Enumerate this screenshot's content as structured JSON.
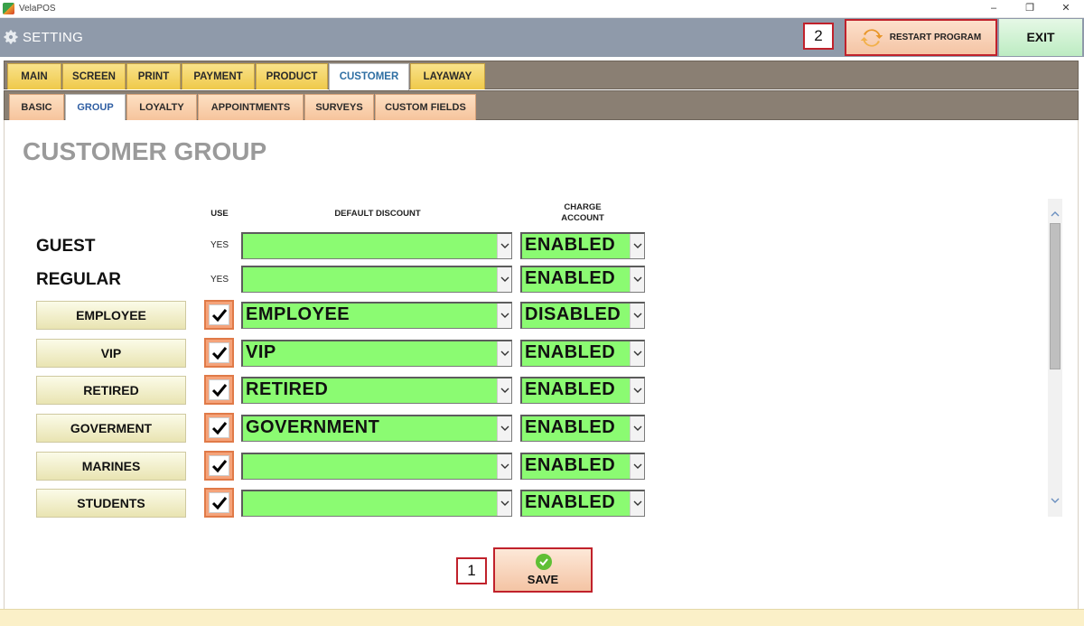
{
  "window": {
    "title": "VelaPOS",
    "min": "–",
    "restore": "❐",
    "close": "✕"
  },
  "header": {
    "title": "SETTING",
    "restart_label": "RESTART PROGRAM",
    "exit_label": "EXIT",
    "marker_restart": "2"
  },
  "main_tabs": [
    {
      "label": "MAIN",
      "active": false
    },
    {
      "label": "SCREEN",
      "active": false
    },
    {
      "label": "PRINT",
      "active": false
    },
    {
      "label": "PAYMENT",
      "active": false
    },
    {
      "label": "PRODUCT",
      "active": false
    },
    {
      "label": "CUSTOMER",
      "active": true
    },
    {
      "label": "LAYAWAY",
      "active": false
    }
  ],
  "sub_tabs": [
    {
      "label": "BASIC",
      "active": false
    },
    {
      "label": "GROUP",
      "active": true
    },
    {
      "label": "LOYALTY",
      "active": false
    },
    {
      "label": "APPOINTMENTS",
      "active": false
    },
    {
      "label": "SURVEYS",
      "active": false
    },
    {
      "label": "CUSTOM FIELDS",
      "active": false
    }
  ],
  "page": {
    "title": "CUSTOMER GROUP",
    "columns": {
      "use": "USE",
      "discount": "DEFAULT DISCOUNT",
      "charge_line1": "CHARGE",
      "charge_line2": "ACCOUNT"
    }
  },
  "fixed_rows": [
    {
      "name": "GUEST",
      "use": "YES",
      "discount": "",
      "charge": "ENABLED"
    },
    {
      "name": "REGULAR",
      "use": "YES",
      "discount": "",
      "charge": "ENABLED"
    }
  ],
  "groups": [
    {
      "name": "EMPLOYEE",
      "use": true,
      "discount": "EMPLOYEE",
      "charge": "DISABLED"
    },
    {
      "name": "VIP",
      "use": true,
      "discount": "VIP",
      "charge": "ENABLED"
    },
    {
      "name": "RETIRED",
      "use": true,
      "discount": "RETIRED",
      "charge": "ENABLED"
    },
    {
      "name": "GOVERMENT",
      "use": true,
      "discount": "GOVERNMENT",
      "charge": "ENABLED"
    },
    {
      "name": "MARINES",
      "use": true,
      "discount": "",
      "charge": "ENABLED"
    },
    {
      "name": "STUDENTS",
      "use": true,
      "discount": "",
      "charge": "ENABLED"
    }
  ],
  "save": {
    "label": "SAVE",
    "marker": "1"
  },
  "colors": {
    "field_green": "#8bfb72",
    "accent_red": "#c0212b",
    "header_gray": "#8f9aaa"
  },
  "icons": {
    "app": "velapos-logo-icon",
    "gear": "gear-icon",
    "restart": "restart-icon",
    "save": "check-circle-icon"
  }
}
